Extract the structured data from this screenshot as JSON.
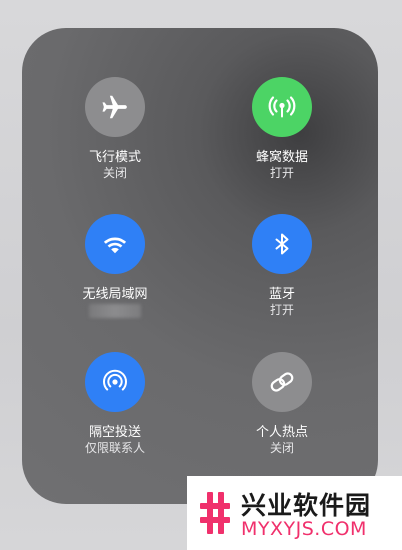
{
  "tiles": {
    "airplane": {
      "label": "飞行模式",
      "status": "关闭",
      "icon": "airplane-icon",
      "color": "#8d8d8f"
    },
    "cellular": {
      "label": "蜂窝数据",
      "status": "打开",
      "icon": "cellular-antenna-icon",
      "color": "#4cd465"
    },
    "wifi": {
      "label": "无线局域网",
      "status": "",
      "icon": "wifi-icon",
      "color": "#2f80f6"
    },
    "bluetooth": {
      "label": "蓝牙",
      "status": "打开",
      "icon": "bluetooth-icon",
      "color": "#2f80f6"
    },
    "airdrop": {
      "label": "隔空投送",
      "status": "仅限联系人",
      "icon": "airdrop-icon",
      "color": "#2f80f6"
    },
    "hotspot": {
      "label": "个人热点",
      "status": "关闭",
      "icon": "hotspot-link-icon",
      "color": "#8d8d8f"
    }
  },
  "watermark": {
    "title": "兴业软件园",
    "url": "MYXYJS.COM",
    "accent": "#f0306c"
  }
}
